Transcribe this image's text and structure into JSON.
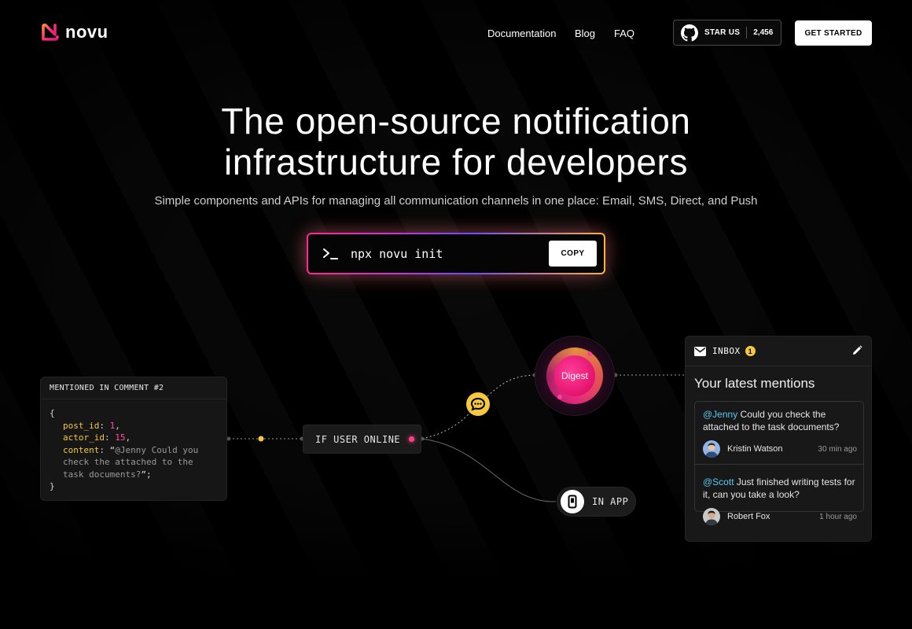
{
  "brand": {
    "name": "novu",
    "accent": "#ff2a8a"
  },
  "nav": {
    "links": [
      "Documentation",
      "Blog",
      "FAQ"
    ],
    "star_label": "STAR US",
    "star_count": "2,456",
    "get_started": "GET STARTED"
  },
  "hero": {
    "title_line1": "The open-source notification",
    "title_line2": "infrastructure for developers",
    "subtitle": "Simple components and APIs for managing all communication channels in one place: Email, SMS, Direct, and Push",
    "command": "npx novu init",
    "copy_label": "COPY"
  },
  "code_card": {
    "header": "MENTIONED IN COMMENT #2",
    "open_brace": "{",
    "close_brace": "}",
    "post_id_key": "post_id",
    "post_id_val": "1",
    "actor_id_key": "actor_id",
    "actor_id_val": "15",
    "content_key": "content",
    "content_open_quote": "“",
    "content_val_line1": "@Jenny Could you",
    "content_val_line2": "check the attached to the",
    "content_val_line3": "task documents?",
    "content_close": "”;"
  },
  "flow": {
    "condition": "IF USER ONLINE",
    "digest": "Digest",
    "in_app": "IN APP"
  },
  "inbox": {
    "title": "INBOX",
    "badge": "1",
    "heading": "Your latest mentions",
    "mentions": [
      {
        "handle": "@Jenny",
        "text": " Could you check the attached to the task documents?",
        "name": "Kristin Watson",
        "time": "30 min ago"
      },
      {
        "handle": "@Scott",
        "text": " Just finished writing tests for it, can you take a look?",
        "name": "Robert Fox",
        "time": "1 hour ago"
      }
    ]
  }
}
